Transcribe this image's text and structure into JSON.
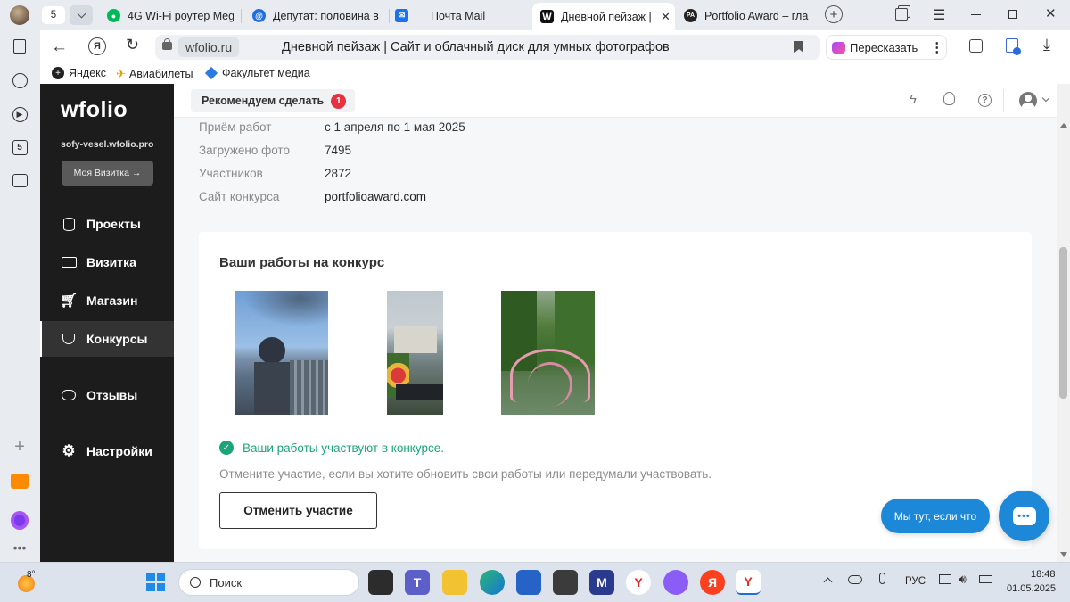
{
  "browser": {
    "tab_count": "5",
    "tabs": [
      {
        "title": "4G Wi-Fi роутер Meg",
        "icon": "megafon-icon"
      },
      {
        "title": "Депутат: половина в",
        "icon": "news-icon"
      },
      {
        "title": "Почта Mail",
        "icon": "mail-icon"
      },
      {
        "title": "Дневной пейзаж |",
        "icon": "wfolio-icon"
      },
      {
        "title": "Portfolio Award – гла",
        "icon": "portfolio-award-icon"
      }
    ],
    "url_domain": "wfolio.ru",
    "page_title": "Дневной пейзаж | Сайт и облачный диск для умных фотографов",
    "retell_label": "Пересказать",
    "bookmarks": [
      "Яндекс",
      "Авиабилеты",
      "Факультет медиа"
    ]
  },
  "sidebar": {
    "logo": "wfolio",
    "site": "sofy-vesel.wfolio.pro",
    "card_button": "Моя Визитка →",
    "items": [
      {
        "label": "Проекты",
        "icon": "database-icon"
      },
      {
        "label": "Визитка",
        "icon": "id-card-icon"
      },
      {
        "label": "Магазин",
        "icon": "cart-icon"
      },
      {
        "label": "Конкурсы",
        "icon": "trophy-icon"
      },
      {
        "label": "Отзывы",
        "icon": "chat-bubbles-icon"
      },
      {
        "label": "Настройки",
        "icon": "gear-icon"
      }
    ]
  },
  "topbar": {
    "recommend_label": "Рекомендуем сделать",
    "recommend_count": "1"
  },
  "contest": {
    "rows": [
      {
        "key": "Приём работ",
        "value": "с 1 апреля по 1 мая 2025"
      },
      {
        "key": "Загружено фото",
        "value": "7495"
      },
      {
        "key": "Участников",
        "value": "2872"
      },
      {
        "key": "Сайт конкурса",
        "value": "portfolioaward.com"
      }
    ],
    "card_title": "Ваши работы на конкурс",
    "status": "Ваши работы участвуют в конкурсе.",
    "note": "Отмените участие, если вы хотите обновить свои работы или передумали участвовать.",
    "cancel_button": "Отменить участие"
  },
  "chat": {
    "bubble": "Мы тут, если что"
  },
  "taskbar": {
    "weather_temp": "8°",
    "search_placeholder": "Поиск",
    "language": "РУС",
    "time": "18:48",
    "date": "01.05.2025"
  }
}
